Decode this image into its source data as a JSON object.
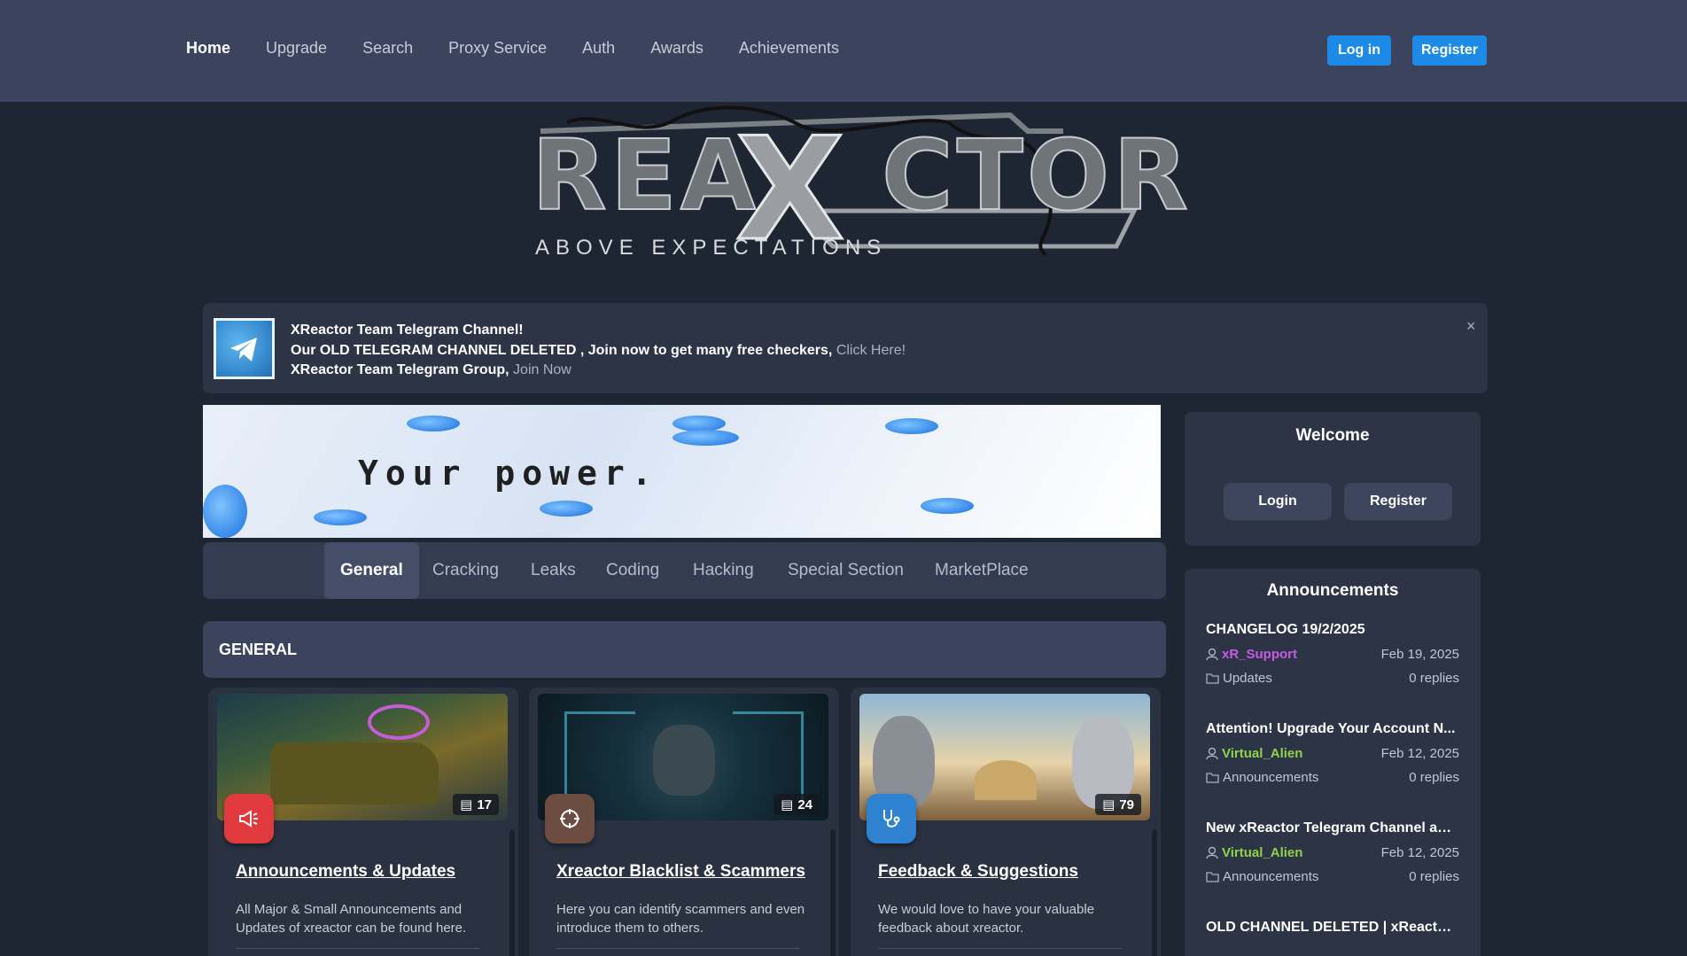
{
  "nav": {
    "links": [
      "Home",
      "Upgrade",
      "Search",
      "Proxy Service",
      "Auth",
      "Awards",
      "Achievements"
    ],
    "login": "Log in",
    "register": "Register"
  },
  "logo": {
    "part1": "REA",
    "x": "X",
    "part2": "CTOR",
    "tagline": "ABOVE EXPECTATIONS"
  },
  "notice": {
    "line1": "XReactor Team Telegram Channel!",
    "line2": "Our OLD TELEGRAM CHANNEL DELETED , Join now to get many free checkers,",
    "line2_link": "Click Here!",
    "line3": "XReactor Team Telegram Group,",
    "line3_link": "Join Now",
    "close": "×"
  },
  "banner": {
    "text": "Your power."
  },
  "tabs": [
    "General",
    "Cracking",
    "Leaks",
    "Coding",
    "Hacking",
    "Special Section",
    "MarketPlace"
  ],
  "section": {
    "title": "GENERAL"
  },
  "cards": [
    {
      "title": "Announcements & Updates",
      "desc": "All Major & Small Announcements and Updates of xreactor can be found here.",
      "count": "17",
      "icon": "megaphone-icon",
      "color": "#e03a3e"
    },
    {
      "title": "Xreactor Blacklist & Scammers",
      "desc": "Here you can identify scammers and even introduce them to others.",
      "count": "24",
      "icon": "crosshair-icon",
      "color": "#6d4c41"
    },
    {
      "title": "Feedback & Suggestions",
      "desc": "We would love to have your valuable feedback about xreactor.",
      "count": "79",
      "icon": "stethoscope-icon",
      "color": "#2f82d0"
    }
  ],
  "welcome": {
    "title": "Welcome",
    "login": "Login",
    "register": "Register"
  },
  "announcements": {
    "title": "Announcements",
    "items": [
      {
        "title": "CHANGELOG 19/2/2025",
        "user": "xR_Support",
        "user_color": "#c45ce6",
        "date": "Feb 19, 2025",
        "category": "Updates",
        "replies": "0 replies"
      },
      {
        "title": "Attention! Upgrade Your Account N...",
        "user": "Virtual_Alien",
        "user_color": "#8fd24a",
        "date": "Feb 12, 2025",
        "category": "Announcements",
        "replies": "0 replies"
      },
      {
        "title": "New xReactor Telegram Channel and...",
        "user": "Virtual_Alien",
        "user_color": "#8fd24a",
        "date": "Feb 12, 2025",
        "category": "Announcements",
        "replies": "0 replies"
      },
      {
        "title": "OLD CHANNEL DELETED | xReactor.o...",
        "user": "",
        "user_color": "#8fd24a",
        "date": "",
        "category": "",
        "replies": ""
      }
    ]
  }
}
